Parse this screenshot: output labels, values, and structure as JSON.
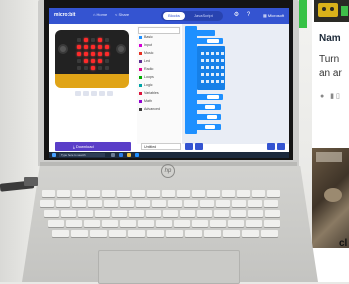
{
  "app": {
    "logo": "micro:bit",
    "nav_home": "Home",
    "nav_share": "Share",
    "mode_blocks": "Blocks",
    "mode_js": "JavaScript",
    "account": "Microsoft"
  },
  "toolbox": {
    "items": [
      {
        "label": "Basic",
        "color": "#1e90ff"
      },
      {
        "label": "Input",
        "color": "#d400d4"
      },
      {
        "label": "Music",
        "color": "#e63022"
      },
      {
        "label": "Led",
        "color": "#5c2d91"
      },
      {
        "label": "Radio",
        "color": "#e3008c"
      },
      {
        "label": "Loops",
        "color": "#00aa00"
      },
      {
        "label": "Logic",
        "color": "#00a4a6"
      },
      {
        "label": "Variables",
        "color": "#dc143c"
      },
      {
        "label": "Math",
        "color": "#9400d3"
      },
      {
        "label": "Advanced",
        "color": "#3c3c3c"
      }
    ]
  },
  "footer": {
    "download_label": "Download",
    "project_name": "Untitled"
  },
  "taskbar": {
    "search_placeholder": "Type here to search"
  },
  "article": {
    "title_partial": "Nam",
    "line1_partial": "Turn",
    "line2_partial": "an ar",
    "footer_partial": "cl"
  },
  "laptop": {
    "brand_mark": "hp"
  },
  "colors": {
    "makecode_blue": "#3454d1",
    "download_purple": "#5a3ec8",
    "led_on": "#ff2a2a",
    "gold_edge": "#e0a417"
  }
}
